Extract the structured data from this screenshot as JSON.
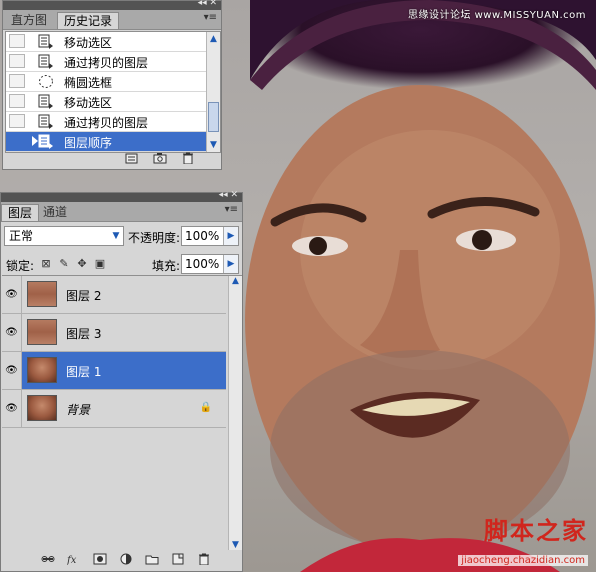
{
  "watermark_top": "思缘设计论坛 www.MISSYUAN.com",
  "watermark_bottom": "脚本之家",
  "watermark_bottom_url": "jiaocheng.chazidian.com",
  "history_panel": {
    "tabs": [
      {
        "label": "直方图",
        "active": false
      },
      {
        "label": "历史记录",
        "active": true
      }
    ],
    "items": [
      {
        "label": "移动选区",
        "icon": "history-state-icon",
        "selected": false
      },
      {
        "label": "通过拷贝的图层",
        "icon": "history-state-icon",
        "selected": false
      },
      {
        "label": "椭圆选框",
        "icon": "ellipse-marquee-icon",
        "selected": false
      },
      {
        "label": "移动选区",
        "icon": "history-state-icon",
        "selected": false
      },
      {
        "label": "通过拷贝的图层",
        "icon": "history-state-icon",
        "selected": false
      },
      {
        "label": "图层顺序",
        "icon": "history-state-icon",
        "selected": true
      }
    ],
    "footer_icons": [
      "new-document-icon",
      "new-snapshot-icon",
      "delete-icon"
    ]
  },
  "layers_panel": {
    "tabs": [
      {
        "label": "图层",
        "active": true
      },
      {
        "label": "通道",
        "active": false
      }
    ],
    "blend_mode": "正常",
    "opacity_label": "不透明度:",
    "opacity_value": "100%",
    "lock_label": "锁定:",
    "fill_label": "填充:",
    "fill_value": "100%",
    "layers": [
      {
        "name": "图层 2",
        "thumb": "eyes",
        "selected": false,
        "italic": false,
        "locked": false
      },
      {
        "name": "图层 3",
        "thumb": "eyes",
        "selected": false,
        "italic": false,
        "locked": false
      },
      {
        "name": "图层 1",
        "thumb": "face",
        "selected": true,
        "italic": false,
        "locked": false
      },
      {
        "name": "背景",
        "thumb": "face",
        "selected": false,
        "italic": true,
        "locked": true
      }
    ],
    "footer_icons": [
      "link-icon",
      "fx-icon",
      "mask-icon",
      "adjustment-icon",
      "group-icon",
      "new-layer-icon",
      "delete-icon"
    ]
  },
  "colors": {
    "selection": "#3c6ec9",
    "panel_bg": "#d6d6d6",
    "accent_red": "#d0261d"
  }
}
